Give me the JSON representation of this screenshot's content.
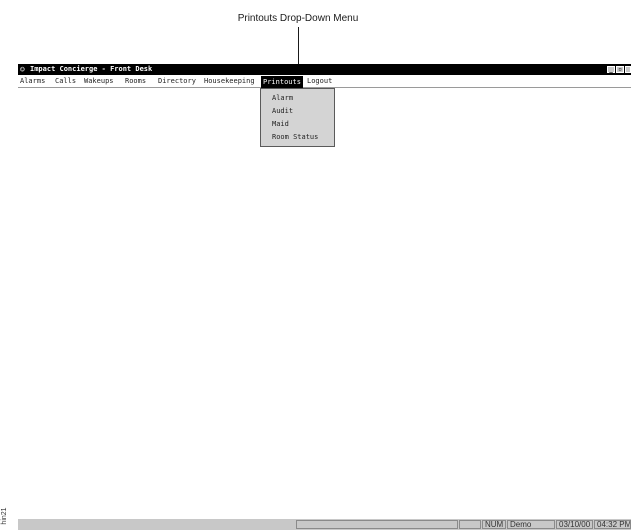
{
  "callout": {
    "label": "Printouts Drop-Down Menu"
  },
  "window": {
    "title": "Impact Concierge - Front Desk",
    "controls": {
      "minimize": "_",
      "restore": "▫",
      "close": ""
    }
  },
  "menubar": {
    "items": [
      {
        "label": "Alarms"
      },
      {
        "label": "Calls"
      },
      {
        "label": "Wakeups"
      },
      {
        "label": "Rooms"
      },
      {
        "label": "Directory"
      },
      {
        "label": "Housekeeping"
      },
      {
        "label": "Printouts"
      },
      {
        "label": "Logout"
      }
    ],
    "active": "Printouts"
  },
  "dropdown": {
    "items": [
      {
        "label": "Alarm"
      },
      {
        "label": "Audit"
      },
      {
        "label": "Maid"
      },
      {
        "label": "Room Status"
      }
    ]
  },
  "statusbar": {
    "message": "",
    "panes": [
      "",
      "",
      "NUM",
      "Demo",
      "03/10/00",
      "04:32 PM"
    ]
  },
  "side_caption": "hin21"
}
